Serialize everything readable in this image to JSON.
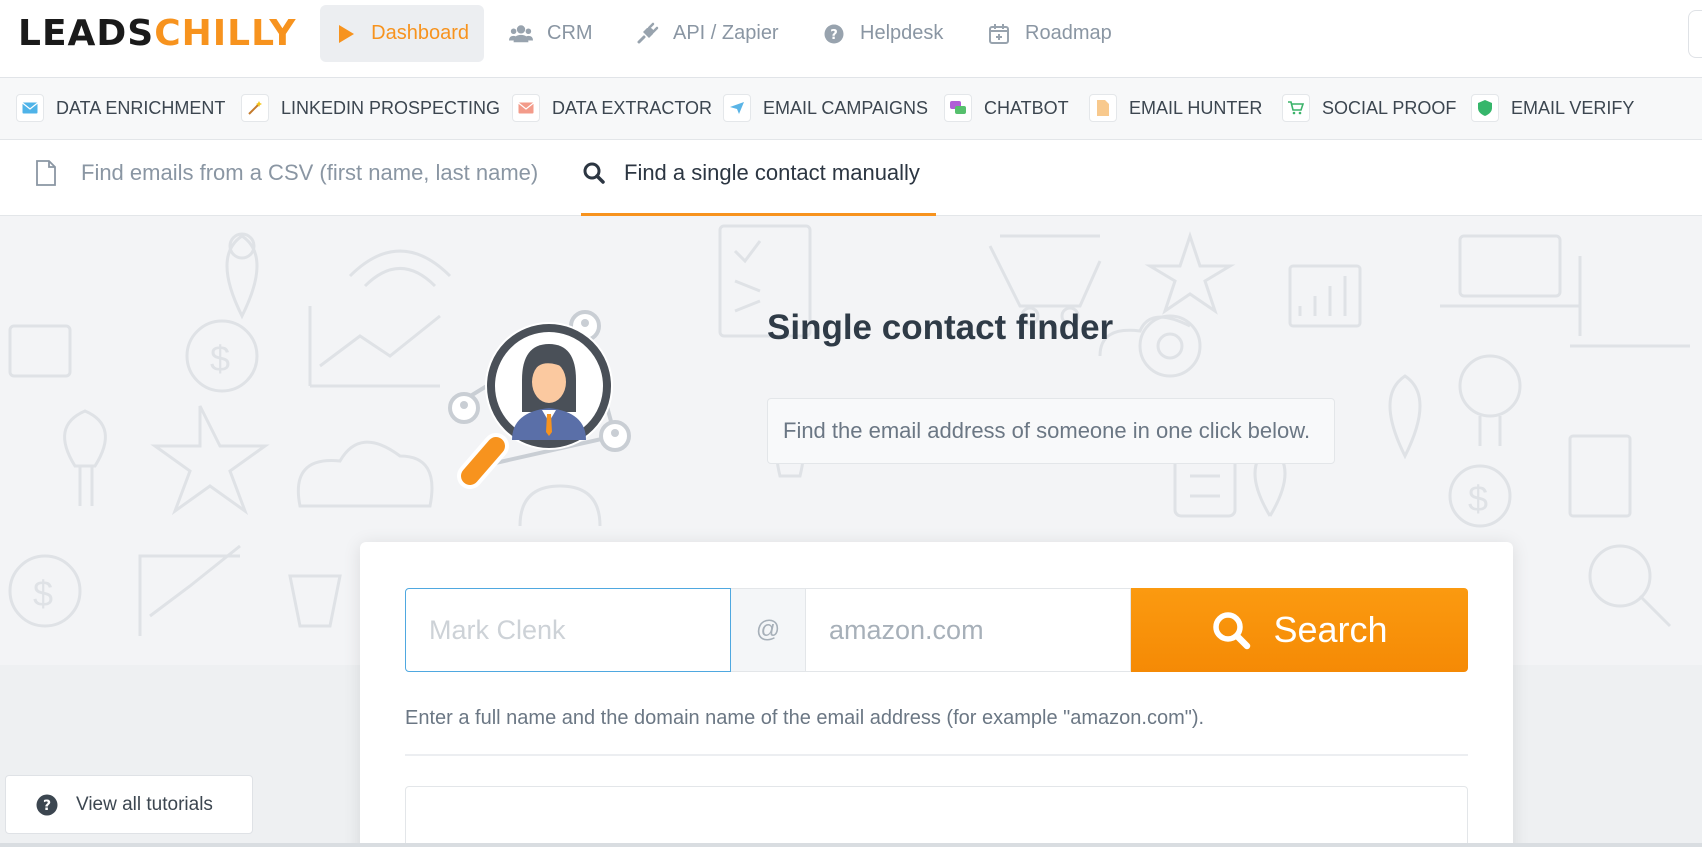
{
  "logo": {
    "part1": "LEADS",
    "part2": "CHILLY"
  },
  "topnav": {
    "items": [
      {
        "label": "Dashboard",
        "icon": "play-icon",
        "active": true
      },
      {
        "label": "CRM",
        "icon": "users-icon",
        "active": false
      },
      {
        "label": "API / Zapier",
        "icon": "plug-icon",
        "active": false
      },
      {
        "label": "Helpdesk",
        "icon": "question-circle-icon",
        "active": false
      },
      {
        "label": "Roadmap",
        "icon": "calendar-plus-icon",
        "active": false
      }
    ]
  },
  "tools": {
    "items": [
      {
        "label": "DATA ENRICHMENT",
        "icon": "envelope-icon"
      },
      {
        "label": "LINKEDIN PROSPECTING",
        "icon": "magic-wand-icon"
      },
      {
        "label": "DATA EXTRACTOR",
        "icon": "mail-icon"
      },
      {
        "label": "EMAIL CAMPAIGNS",
        "icon": "paper-plane-icon"
      },
      {
        "label": "CHATBOT",
        "icon": "chat-icon"
      },
      {
        "label": "EMAIL HUNTER",
        "icon": "document-icon"
      },
      {
        "label": "SOCIAL PROOF",
        "icon": "cart-icon"
      },
      {
        "label": "EMAIL VERIFY",
        "icon": "shield-icon"
      }
    ]
  },
  "tabs": {
    "csv_label": "Find emails from a CSV (first name, last name)",
    "single_label": "Find a single contact manually"
  },
  "hero": {
    "title": "Single contact finder",
    "subtitle": "Find the email address of someone in one click below."
  },
  "search": {
    "name_placeholder": "Mark Clenk",
    "at_symbol": "@",
    "domain_placeholder": "amazon.com",
    "button_label": "Search",
    "help_text": "Enter a full name and the domain name of the email address (for example \"amazon.com\")."
  },
  "tutorials": {
    "label": "View all tutorials"
  },
  "colors": {
    "accent": "#f7931e",
    "focus_border": "#4fa8e0",
    "text_dark": "#2f3b47",
    "text_muted": "#8a96a3"
  }
}
